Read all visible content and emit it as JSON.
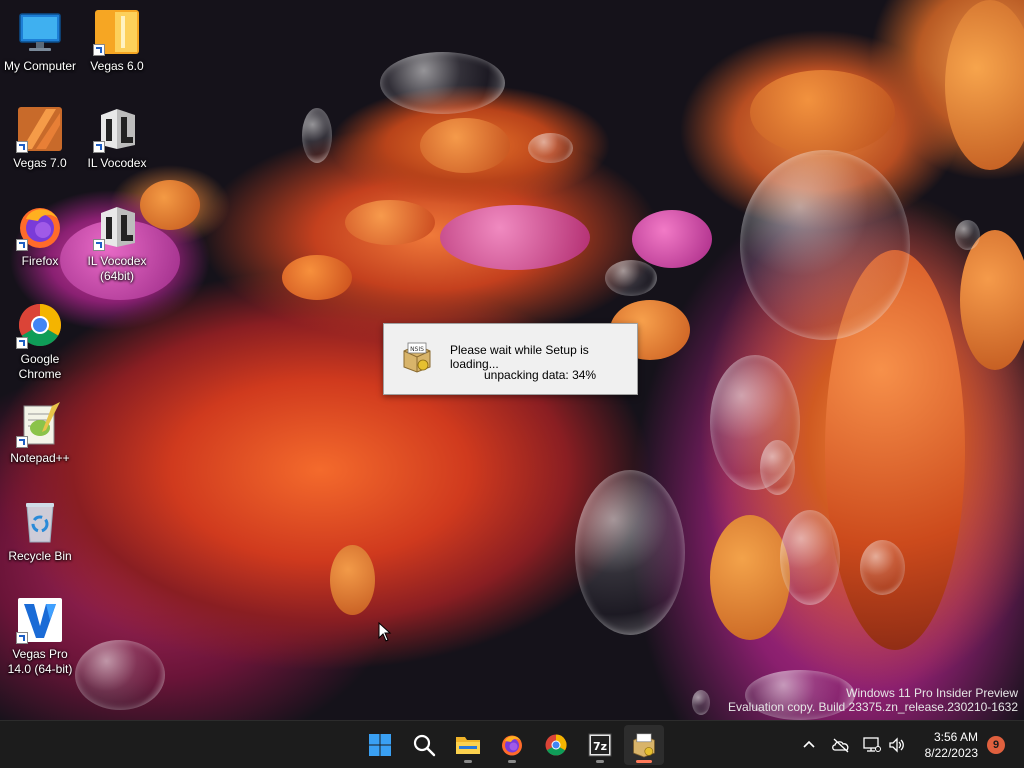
{
  "desktop_icons": [
    {
      "label": "My Computer",
      "icon": "monitor-icon",
      "shortcut": false
    },
    {
      "label": "Vegas 6.0",
      "icon": "vegas-icon",
      "shortcut": true
    },
    {
      "label": "Vegas 7.0",
      "icon": "vegas-icon",
      "shortcut": true
    },
    {
      "label": "IL Vocodex",
      "icon": "il-vocodex-icon",
      "shortcut": true
    },
    {
      "label": "Firefox",
      "icon": "firefox-icon",
      "shortcut": true
    },
    {
      "label": "IL Vocodex (64bit)",
      "icon": "il-vocodex-icon",
      "shortcut": true
    },
    {
      "label": "Google Chrome",
      "icon": "chrome-icon",
      "shortcut": true
    },
    {
      "label": "Notepad++",
      "icon": "notepad-plus-plus-icon",
      "shortcut": true
    },
    {
      "label": "Recycle Bin",
      "icon": "recycle-bin-icon",
      "shortcut": false
    },
    {
      "label": "Vegas Pro 14.0 (64-bit)",
      "icon": "vegas-pro-icon",
      "shortcut": true
    }
  ],
  "dialog": {
    "message": "Please wait while Setup is loading...",
    "progress_text": "unpacking data: 34%",
    "progress": 0.34,
    "icon": "nsis-installer-icon"
  },
  "watermark": {
    "line1": "Windows 11 Pro Insider Preview",
    "line2": "Evaluation copy. Build 23375.zn_release.230210-1632"
  },
  "taskbar": {
    "apps": [
      {
        "name": "start",
        "icon": "windows-start-icon",
        "running": false,
        "active": false
      },
      {
        "name": "search",
        "icon": "search-icon",
        "running": false,
        "active": false
      },
      {
        "name": "file-explorer",
        "icon": "folder-icon",
        "running": true,
        "active": false
      },
      {
        "name": "firefox",
        "icon": "firefox-icon",
        "running": true,
        "active": false
      },
      {
        "name": "chrome",
        "icon": "chrome-icon",
        "running": false,
        "active": false
      },
      {
        "name": "7zip",
        "icon": "7zip-icon",
        "running": true,
        "active": false,
        "label": "7z"
      },
      {
        "name": "setup",
        "icon": "nsis-installer-icon",
        "running": true,
        "active": true
      }
    ],
    "tray": {
      "icons": [
        "chevron-up-icon",
        "onedrive-icon",
        "network-icon",
        "volume-icon"
      ],
      "time": "3:56 AM",
      "date": "8/22/2023",
      "notification_count": "9"
    }
  },
  "colors": {
    "taskbar_bg": "#1c1c1c",
    "dialog_bg": "#f0f0f0",
    "notif_badge": "#e0603e",
    "active_indicator": "#ff7a5a"
  }
}
